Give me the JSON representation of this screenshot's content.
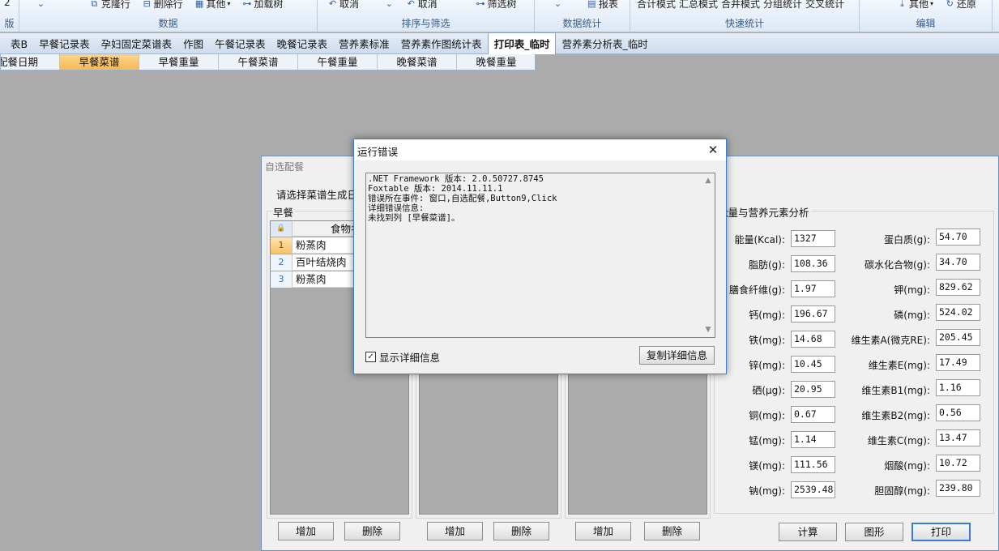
{
  "ribbon": {
    "groups": [
      {
        "label": "版",
        "buttons": [
          "2"
        ]
      },
      {
        "label": "数据",
        "buttons": [
          "克隆行",
          "删除行",
          "其他",
          "加载树"
        ]
      },
      {
        "label": "排序与筛选",
        "buttons": [
          "取消",
          "取消",
          "筛选树"
        ]
      },
      {
        "label": "数据统计",
        "buttons": [
          "报表"
        ]
      },
      {
        "label": "快速统计",
        "buttons": [
          "合计模式",
          "汇总模式",
          "合并模式",
          "分组统计",
          "交叉统计"
        ]
      },
      {
        "label": "编辑",
        "buttons": [
          "其他",
          "还原"
        ]
      }
    ]
  },
  "tabs": [
    "表B",
    "早餐记录表",
    "孕妇固定菜谱表",
    "作图",
    "午餐记录表",
    "晚餐记录表",
    "营养素标准",
    "营养素作图统计表",
    "打印表_临时",
    "营养素分析表_临时"
  ],
  "active_tab": "打印表_临时",
  "columns": [
    "配餐日期",
    "早餐菜谱",
    "早餐重量",
    "午餐菜谱",
    "午餐重量",
    "晚餐菜谱",
    "晚餐重量"
  ],
  "active_column": "早餐菜谱",
  "window": {
    "title": "自选配餐",
    "prompt": "请选择菜谱生成日",
    "breakfast_label": "早餐",
    "food_name_header": "食物名称",
    "rows": [
      "粉蒸肉",
      "百叶结烧肉",
      "粉蒸肉"
    ],
    "add_label": "增加",
    "delete_label": "删除",
    "analysis_title": "能量与营养元素分析",
    "nutrients_left": [
      {
        "label": "能量(Kcal):",
        "value": "1327"
      },
      {
        "label": "脂肪(g):",
        "value": "108.36"
      },
      {
        "label": "膳食纤维(g):",
        "value": "1.97"
      },
      {
        "label": "钙(mg):",
        "value": "196.67"
      },
      {
        "label": "铁(mg):",
        "value": "14.68"
      },
      {
        "label": "锌(mg):",
        "value": "10.45"
      },
      {
        "label": "硒(μg):",
        "value": "20.95"
      },
      {
        "label": "铜(mg):",
        "value": "0.67"
      },
      {
        "label": "锰(mg):",
        "value": "1.14"
      },
      {
        "label": "镁(mg):",
        "value": "111.56"
      },
      {
        "label": "钠(mg):",
        "value": "2539.48"
      }
    ],
    "nutrients_right": [
      {
        "label": "蛋白质(g):",
        "value": "54.70"
      },
      {
        "label": "碳水化合物(g):",
        "value": "34.70"
      },
      {
        "label": "钾(mg):",
        "value": "829.62"
      },
      {
        "label": "磷(mg):",
        "value": "524.02"
      },
      {
        "label": "维生素A(微克RE):",
        "value": "205.45"
      },
      {
        "label": "维生素E(mg):",
        "value": "17.49"
      },
      {
        "label": "维生素B1(mg):",
        "value": "1.16"
      },
      {
        "label": "维生素B2(mg):",
        "value": "0.56"
      },
      {
        "label": "维生素C(mg):",
        "value": "13.47"
      },
      {
        "label": "烟酸(mg):",
        "value": "10.72"
      },
      {
        "label": "胆固醇(mg):",
        "value": "239.80"
      }
    ],
    "calc_label": "计算",
    "chart_label": "图形",
    "print_label": "打印"
  },
  "dialog": {
    "title": "运行错误",
    "close_glyph": "✕",
    "lines": [
      ".NET Framework 版本: 2.0.50727.8745",
      "Foxtable 版本: 2014.11.11.1",
      "错误所在事件: 窗口,自选配餐,Button9,Click",
      "详细错误信息:",
      "未找到列 [早餐菜谱]。"
    ],
    "show_details_label": "显示详细信息",
    "show_details_checked": true,
    "copy_label": "复制详细信息"
  },
  "colors": {
    "accent": "#3c7fd1",
    "active_column": "#f7b955",
    "ribbon_label": "#3b5d88"
  }
}
